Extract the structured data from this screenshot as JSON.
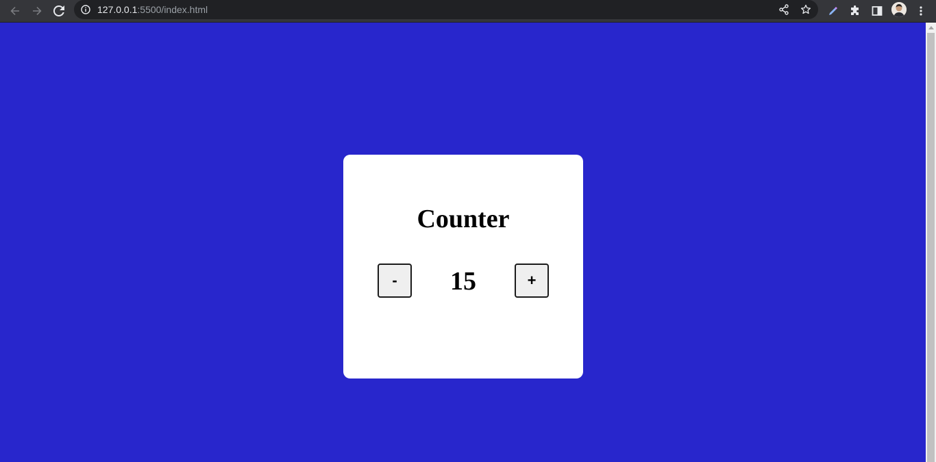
{
  "browser": {
    "url_host": "127.0.0.1",
    "url_path": ":5500/index.html",
    "icons": {
      "back": "back-arrow-icon",
      "forward": "forward-arrow-icon",
      "reload": "reload-icon",
      "info": "info-icon",
      "share": "share-icon",
      "bookmark": "star-icon",
      "eyedropper": "eyedropper-icon",
      "extensions": "puzzle-icon",
      "side_panel": "side-panel-icon",
      "menu": "kebab-menu-icon"
    }
  },
  "page": {
    "background_color": "#2826cc",
    "card": {
      "title": "Counter",
      "decrement_label": "-",
      "increment_label": "+",
      "value": "15"
    }
  }
}
